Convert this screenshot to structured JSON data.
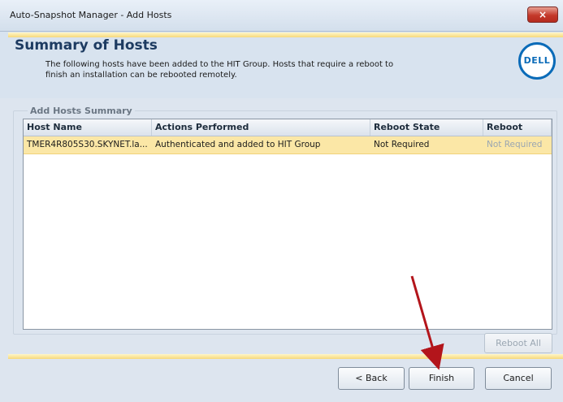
{
  "window": {
    "title": "Auto-Snapshot Manager - Add Hosts",
    "close_label": "×"
  },
  "header": {
    "title": "Summary of Hosts",
    "description": "The following hosts have been added to the HIT Group.  Hosts that require a reboot to finish an installation can be rebooted remotely.",
    "logo_text": "DELL"
  },
  "summary": {
    "group_label": "Add Hosts Summary",
    "columns": [
      "Host Name",
      "Actions Performed",
      "Reboot State",
      "Reboot"
    ],
    "rows": [
      {
        "host_name": "TMER4R805S30.SKYNET.la...",
        "actions_performed": "Authenticated and added to HIT Group",
        "reboot_state": "Not Required",
        "reboot": "Not Required"
      }
    ]
  },
  "buttons": {
    "reboot_all": "Reboot All",
    "back": "< Back",
    "finish": "Finish",
    "cancel": "Cancel"
  },
  "colors": {
    "selected_row": "#fbe7a6",
    "accent_rule": "#f6d97c",
    "arrow": "#b3151b",
    "logo_blue": "#0a6bb8"
  }
}
